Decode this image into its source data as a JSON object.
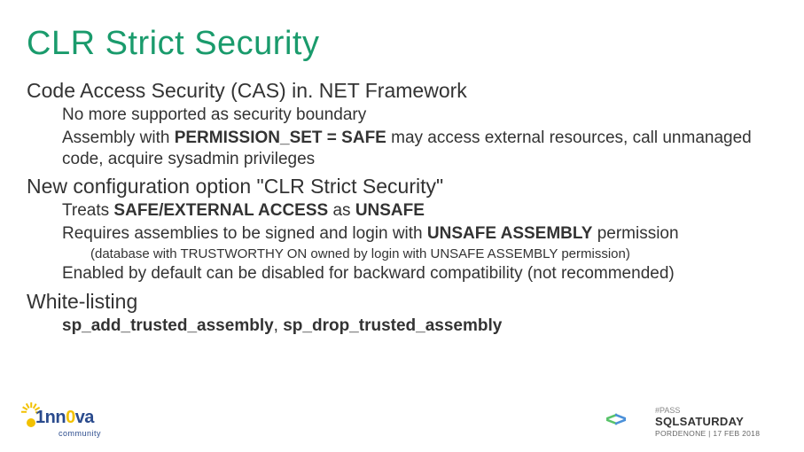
{
  "title": "CLR Strict Security",
  "section1": {
    "heading": "Code Access Security (CAS) in. NET Framework",
    "line1": "No more supported as security boundary",
    "line2_a": "Assembly with ",
    "line2_b": "PERMISSION_SET = SAFE",
    "line2_c": " may access external resources, call unmanaged code, acquire sysadmin privileges"
  },
  "section2": {
    "heading": "New configuration option \"CLR Strict Security\"",
    "line1_a": "Treats ",
    "line1_b": "SAFE/EXTERNAL ACCESS",
    "line1_c": " as ",
    "line1_d": "UNSAFE",
    "line2_a": "Requires assemblies to be signed and login with ",
    "line2_b": "UNSAFE ASSEMBLY",
    "line2_c": " permission",
    "note": "(database with TRUSTWORTHY ON owned by login with UNSAFE ASSEMBLY permission)",
    "line3": "Enabled by default can be disabled for backward compatibility (not recommended)"
  },
  "section3": {
    "heading": "White-listing",
    "line1_a": "sp_add_trusted_assembly",
    "line1_b": ", ",
    "line1_c": "sp_drop_trusted_assembly"
  },
  "footer": {
    "left_logo_text_a": "1nn",
    "left_logo_text_b": "0",
    "left_logo_text_c": "va",
    "left_logo_sub": "community",
    "right_pass": "#PASS",
    "right_main": "SQLSATURDAY",
    "right_sub": "PORDENONE | 17 FEB 2018"
  }
}
